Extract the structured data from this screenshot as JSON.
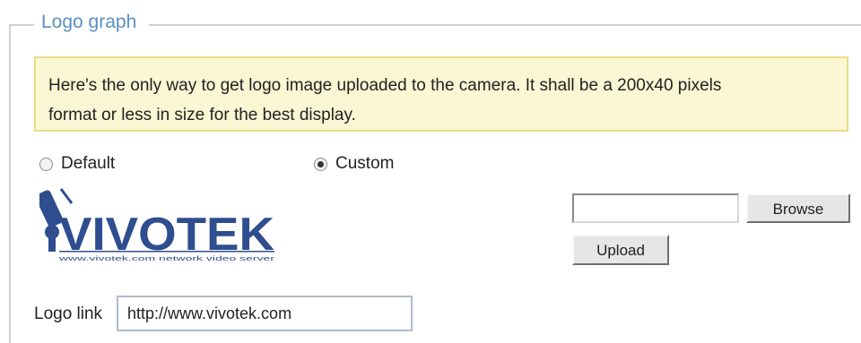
{
  "section": {
    "legend": "Logo graph"
  },
  "notice": {
    "line1": "Here's the only way to get logo image uploaded to the camera. It shall be a 200x40 pixels",
    "line2": "format or less in size for the best display."
  },
  "logo_options": {
    "default_label": "Default",
    "custom_label": "Custom",
    "selected": "custom"
  },
  "logo_image": {
    "text": "VIVOTEK",
    "subtext": "www.vivotek.com  network video server",
    "color": "#2f4e8f"
  },
  "file_picker": {
    "value": "",
    "browse_label": "Browse",
    "upload_label": "Upload"
  },
  "logo_link": {
    "label": "Logo link",
    "value": "http://www.vivotek.com"
  }
}
